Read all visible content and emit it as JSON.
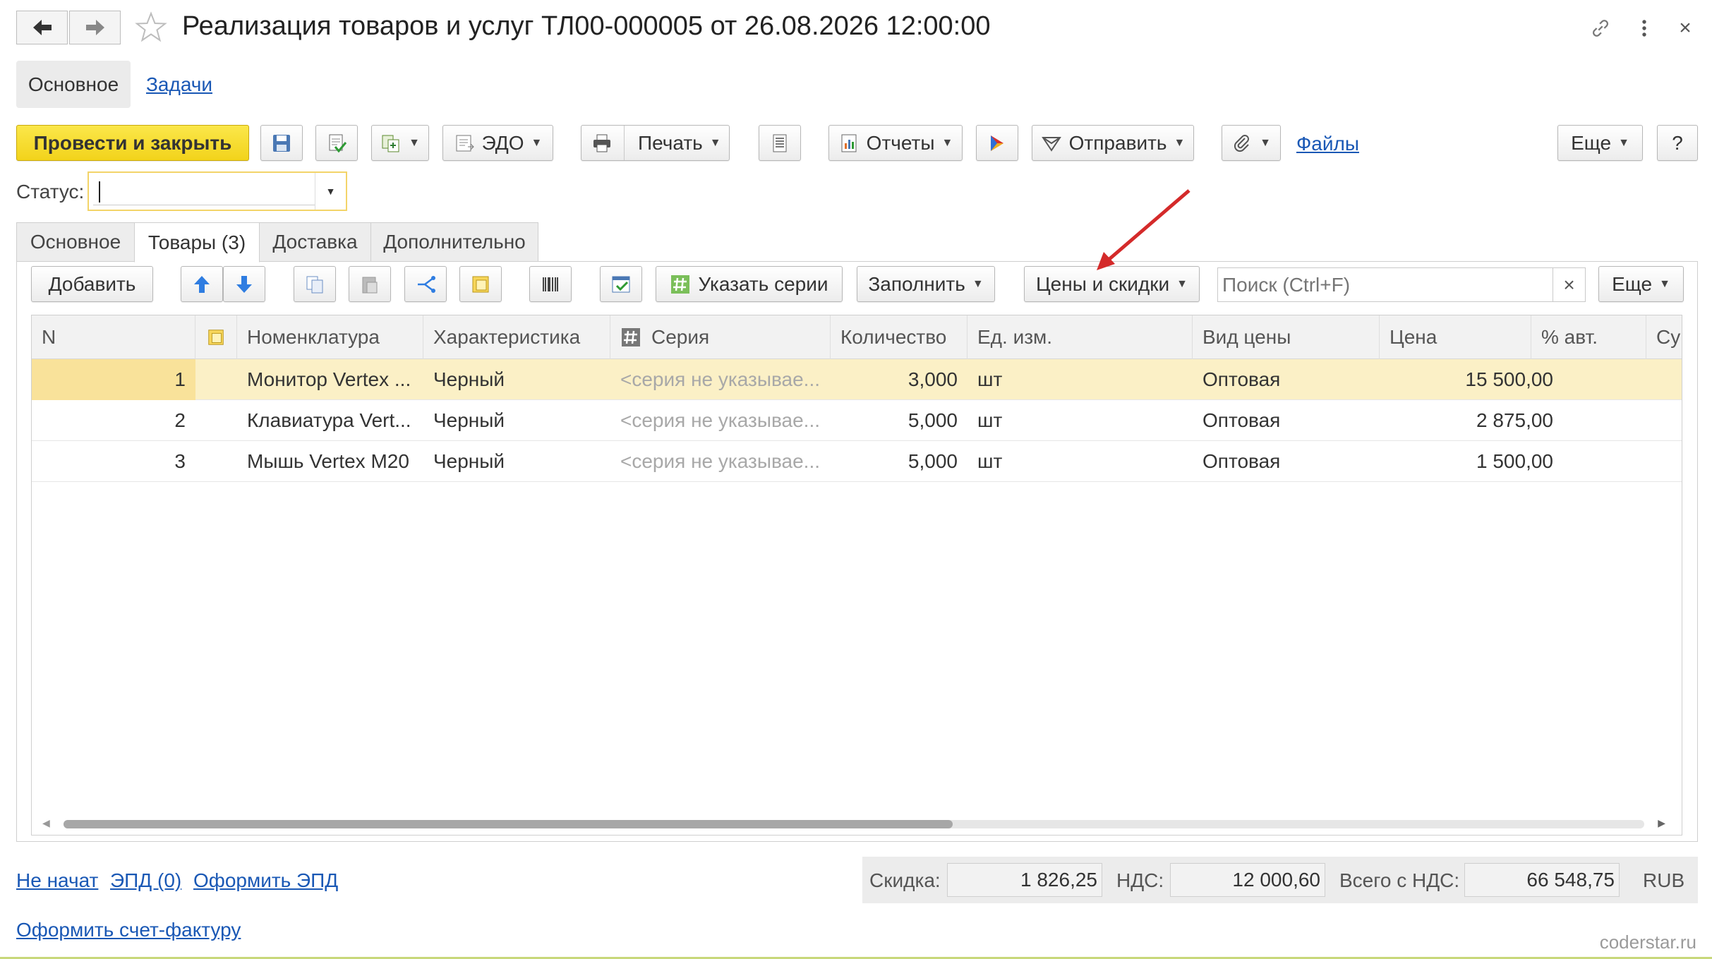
{
  "window": {
    "title": "Реализация товаров и услуг ТЛ00-000005 от 26.08.2026 12:00:00",
    "back_icon": "arrow-left-icon",
    "forward_icon": "arrow-right-icon",
    "favorite_icon": "star-icon",
    "link_icon": "link-icon",
    "menu_icon": "more-vertical-icon",
    "close_label": "×"
  },
  "sections": {
    "main": "Основное",
    "tasks": "Задачи"
  },
  "toolbar": {
    "post_and_close": "Провести и закрыть",
    "edo": "ЭДО",
    "print": "Печать",
    "reports": "Отчеты",
    "send": "Отправить",
    "files": "Файлы",
    "more": "Еще",
    "help": "?"
  },
  "status": {
    "label": "Статус:",
    "value": ""
  },
  "tabs": [
    {
      "label": "Основное"
    },
    {
      "label": "Товары (3)"
    },
    {
      "label": "Доставка"
    },
    {
      "label": "Дополнительно"
    }
  ],
  "goods_toolbar": {
    "add": "Добавить",
    "specify_series": "Указать серии",
    "fill": "Заполнить",
    "prices_discounts": "Цены и скидки",
    "search_placeholder": "Поиск (Ctrl+F)",
    "clear": "×",
    "more": "Еще"
  },
  "table": {
    "columns": [
      "N",
      "",
      "Номенклатура",
      "Характеристика",
      "Серия",
      "Количество",
      "Ед. изм.",
      "Вид цены",
      "Цена",
      "% авт.",
      "Су"
    ],
    "rows": [
      {
        "n": "1",
        "name": "Монитор Vertex ...",
        "char": "Черный",
        "series": "<серия не указывае...",
        "qty": "3,000",
        "unit": "шт",
        "price_type": "Оптовая",
        "price": "15 500,00",
        "auto": ""
      },
      {
        "n": "2",
        "name": "Клавиатура Vert...",
        "char": "Черный",
        "series": "<серия не указывае...",
        "qty": "5,000",
        "unit": "шт",
        "price_type": "Оптовая",
        "price": "2 875,00",
        "auto": ""
      },
      {
        "n": "3",
        "name": "Мышь Vertex M20",
        "char": "Черный",
        "series": "<серия не указывае...",
        "qty": "5,000",
        "unit": "шт",
        "price_type": "Оптовая",
        "price": "1 500,00",
        "auto": ""
      }
    ],
    "selected_row": 1
  },
  "footer": {
    "not_started": "Не начат",
    "epd": "ЭПД (0)",
    "make_epd": "Оформить ЭПД",
    "make_invoice": "Оформить счет-фактуру",
    "discount_label": "Скидка:",
    "discount_value": "1 826,25",
    "vat_label": "НДС:",
    "vat_value": "12 000,60",
    "total_label": "Всего с НДС:",
    "total_value": "66 548,75",
    "currency": "RUB"
  },
  "watermark": "coderstar.ru",
  "colors": {
    "primary_button": "#f2d31b",
    "link": "#1a58b5",
    "selected_row": "#fbf0c6",
    "annotation_arrow": "#d42a2a"
  }
}
